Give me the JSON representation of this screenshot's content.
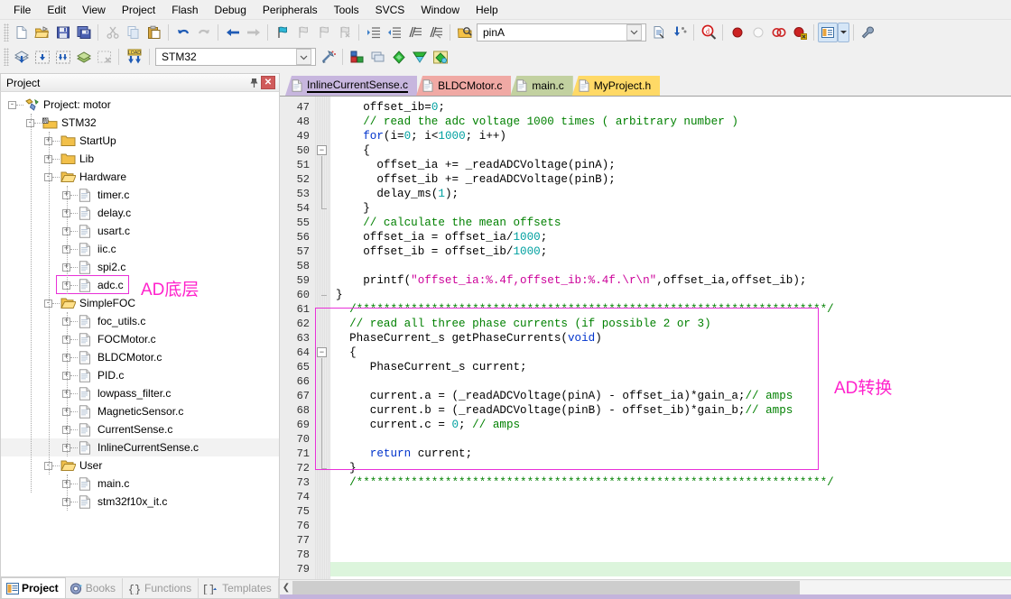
{
  "menu": {
    "items": [
      "File",
      "Edit",
      "View",
      "Project",
      "Flash",
      "Debug",
      "Peripherals",
      "Tools",
      "SVCS",
      "Window",
      "Help"
    ]
  },
  "toolbar1": {
    "icons": [
      "new-file-icon",
      "open-file-icon",
      "save-icon",
      "save-all-icon",
      "cut-icon",
      "copy-icon",
      "paste-icon",
      "undo-icon",
      "redo-icon",
      "navigate-back-icon",
      "navigate-forward-icon",
      "bookmark-toggle-icon",
      "bookmark-prev-icon",
      "bookmark-next-icon",
      "bookmark-clear-icon",
      "indent-right-icon",
      "indent-left-icon",
      "comment-icon",
      "uncomment-icon",
      "find-in-files-icon"
    ],
    "search_value": "pinA",
    "search_placeholder": "",
    "combo_arrow": "chevron-down-icon",
    "after_icons": [
      "browse-symbols-icon",
      "find-references-icon",
      "find-icon",
      "insert-breakpoint-icon",
      "disable-breakpoint-icon",
      "kill-all-breakpoints-icon",
      "disable-all-breakpoints-icon"
    ],
    "window_button": "manage-windows-icon",
    "window_arrow": "chevron-down-icon",
    "config_button": "configure-icon"
  },
  "toolbar2": {
    "icons": [
      "build-icon",
      "rebuild-icon",
      "batch-build-icon",
      "translate-icon",
      "stop-build-icon",
      "download-icon"
    ],
    "target_value": "STM32",
    "target_arrow": "chevron-down-icon",
    "after_icons": [
      "target-options-icon",
      "manage-project-items-icon",
      "manage-multi-project-icon",
      "pack-installer-icon",
      "manage-runtime-icon",
      "software-packs-icon"
    ]
  },
  "project_pane": {
    "title": "Project",
    "pin_icon": "pin-icon",
    "close_icon": "close-icon",
    "tree": [
      {
        "label": "Project: motor",
        "depth": 0,
        "icon": "project-icon",
        "expander": "-",
        "selected": false
      },
      {
        "label": "STM32",
        "depth": 1,
        "icon": "target-icon",
        "expander": "-",
        "selected": false
      },
      {
        "label": "StartUp",
        "depth": 2,
        "icon": "folder-icon",
        "expander": "+",
        "selected": false
      },
      {
        "label": "Lib",
        "depth": 2,
        "icon": "folder-icon",
        "expander": "+",
        "selected": false
      },
      {
        "label": "Hardware",
        "depth": 2,
        "icon": "folder-open-icon",
        "expander": "-",
        "selected": false
      },
      {
        "label": "timer.c",
        "depth": 3,
        "icon": "c-file-icon",
        "expander": "+",
        "selected": false
      },
      {
        "label": "delay.c",
        "depth": 3,
        "icon": "c-file-icon",
        "expander": "+",
        "selected": false
      },
      {
        "label": "usart.c",
        "depth": 3,
        "icon": "c-file-icon",
        "expander": "+",
        "selected": false
      },
      {
        "label": "iic.c",
        "depth": 3,
        "icon": "c-file-icon",
        "expander": "+",
        "selected": false
      },
      {
        "label": "spi2.c",
        "depth": 3,
        "icon": "c-file-icon",
        "expander": "+",
        "selected": false
      },
      {
        "label": "adc.c",
        "depth": 3,
        "icon": "c-file-icon",
        "expander": "+",
        "selected": false
      },
      {
        "label": "SimpleFOC",
        "depth": 2,
        "icon": "folder-open-icon",
        "expander": "-",
        "selected": false
      },
      {
        "label": "foc_utils.c",
        "depth": 3,
        "icon": "c-file-icon",
        "expander": "+",
        "selected": false
      },
      {
        "label": "FOCMotor.c",
        "depth": 3,
        "icon": "c-file-icon",
        "expander": "+",
        "selected": false
      },
      {
        "label": "BLDCMotor.c",
        "depth": 3,
        "icon": "c-file-icon",
        "expander": "+",
        "selected": false
      },
      {
        "label": "PID.c",
        "depth": 3,
        "icon": "c-file-icon",
        "expander": "+",
        "selected": false
      },
      {
        "label": "lowpass_filter.c",
        "depth": 3,
        "icon": "c-file-icon",
        "expander": "+",
        "selected": false
      },
      {
        "label": "MagneticSensor.c",
        "depth": 3,
        "icon": "c-file-icon",
        "expander": "+",
        "selected": false
      },
      {
        "label": "CurrentSense.c",
        "depth": 3,
        "icon": "c-file-icon",
        "expander": "+",
        "selected": false
      },
      {
        "label": "InlineCurrentSense.c",
        "depth": 3,
        "icon": "c-file-icon",
        "expander": "+",
        "selected": true
      },
      {
        "label": "User",
        "depth": 2,
        "icon": "folder-open-icon",
        "expander": "-",
        "selected": false
      },
      {
        "label": "main.c",
        "depth": 3,
        "icon": "c-file-icon",
        "expander": "+",
        "selected": false
      },
      {
        "label": "stm32f10x_it.c",
        "depth": 3,
        "icon": "c-file-icon",
        "expander": "+",
        "selected": false
      }
    ],
    "bottom_tabs": [
      {
        "label": "Project",
        "icon": "project-tab-icon",
        "active": true
      },
      {
        "label": "Books",
        "icon": "books-tab-icon",
        "active": false
      },
      {
        "label": "Functions",
        "icon": "functions-tab-icon",
        "active": false
      },
      {
        "label": "Templates",
        "icon": "templates-tab-icon",
        "active": false
      }
    ]
  },
  "annotations": {
    "sidebar": {
      "text": "AD底层",
      "color": "#ff22cc"
    },
    "editor": {
      "text": "AD转换",
      "color": "#ff22cc"
    }
  },
  "editor": {
    "tabs": [
      {
        "label": "InlineCurrentSense.c",
        "color": "#c7b6de",
        "active": true
      },
      {
        "label": "BLDCMotor.c",
        "color": "#f0a9a4",
        "active": false
      },
      {
        "label": "main.c",
        "color": "#c2d1a0",
        "active": false
      },
      {
        "label": "MyProject.h",
        "color": "#ffd966",
        "active": false
      }
    ],
    "first_line_number": 47,
    "last_line_number": 79,
    "highlighted_line": 79,
    "lines": [
      {
        "n": 47,
        "tokens": [
          {
            "t": "    offset_ib=",
            "c": "plain"
          },
          {
            "t": "0",
            "c": "num"
          },
          {
            "t": ";",
            "c": "plain"
          }
        ]
      },
      {
        "n": 48,
        "tokens": [
          {
            "t": "    // read the adc voltage 1000 times ( arbitrary number )",
            "c": "cm"
          }
        ]
      },
      {
        "n": 49,
        "tokens": [
          {
            "t": "    ",
            "c": "plain"
          },
          {
            "t": "for",
            "c": "kw"
          },
          {
            "t": "(i=",
            "c": "plain"
          },
          {
            "t": "0",
            "c": "num"
          },
          {
            "t": "; i<",
            "c": "plain"
          },
          {
            "t": "1000",
            "c": "num"
          },
          {
            "t": "; i++)",
            "c": "plain"
          }
        ]
      },
      {
        "n": 50,
        "tokens": [
          {
            "t": "    {",
            "c": "plain"
          }
        ]
      },
      {
        "n": 51,
        "tokens": [
          {
            "t": "      offset_ia += _readADCVoltage(pinA);",
            "c": "plain"
          }
        ]
      },
      {
        "n": 52,
        "tokens": [
          {
            "t": "      offset_ib += _readADCVoltage(pinB);",
            "c": "plain"
          }
        ]
      },
      {
        "n": 53,
        "tokens": [
          {
            "t": "      delay_ms(",
            "c": "plain"
          },
          {
            "t": "1",
            "c": "num"
          },
          {
            "t": ");",
            "c": "plain"
          }
        ]
      },
      {
        "n": 54,
        "tokens": [
          {
            "t": "    }",
            "c": "plain"
          }
        ]
      },
      {
        "n": 55,
        "tokens": [
          {
            "t": "    // calculate the mean offsets",
            "c": "cm"
          }
        ]
      },
      {
        "n": 56,
        "tokens": [
          {
            "t": "    offset_ia = offset_ia/",
            "c": "plain"
          },
          {
            "t": "1000",
            "c": "num"
          },
          {
            "t": ";",
            "c": "plain"
          }
        ]
      },
      {
        "n": 57,
        "tokens": [
          {
            "t": "    offset_ib = offset_ib/",
            "c": "plain"
          },
          {
            "t": "1000",
            "c": "num"
          },
          {
            "t": ";",
            "c": "plain"
          }
        ]
      },
      {
        "n": 58,
        "tokens": [
          {
            "t": "",
            "c": "plain"
          }
        ]
      },
      {
        "n": 59,
        "tokens": [
          {
            "t": "    printf(",
            "c": "plain"
          },
          {
            "t": "\"offset_ia:%.4f,offset_ib:%.4f.\\r\\n\"",
            "c": "str"
          },
          {
            "t": ",offset_ia,offset_ib);",
            "c": "plain"
          }
        ]
      },
      {
        "n": 60,
        "tokens": [
          {
            "t": "}",
            "c": "plain"
          }
        ]
      },
      {
        "n": 61,
        "tokens": [
          {
            "t": "  /*********************************************************************/",
            "c": "cm"
          }
        ]
      },
      {
        "n": 62,
        "tokens": [
          {
            "t": "  // read all three phase currents (if possible 2 or 3)",
            "c": "cm"
          }
        ]
      },
      {
        "n": 63,
        "tokens": [
          {
            "t": "  PhaseCurrent_s getPhaseCurrents(",
            "c": "plain"
          },
          {
            "t": "void",
            "c": "kw"
          },
          {
            "t": ")",
            "c": "plain"
          }
        ]
      },
      {
        "n": 64,
        "tokens": [
          {
            "t": "  {",
            "c": "plain"
          }
        ]
      },
      {
        "n": 65,
        "tokens": [
          {
            "t": "     PhaseCurrent_s current;",
            "c": "plain"
          }
        ]
      },
      {
        "n": 66,
        "tokens": [
          {
            "t": "",
            "c": "plain"
          }
        ]
      },
      {
        "n": 67,
        "tokens": [
          {
            "t": "     current.a = (_readADCVoltage(pinA) - offset_ia)*gain_a;",
            "c": "plain"
          },
          {
            "t": "// amps",
            "c": "cm"
          }
        ]
      },
      {
        "n": 68,
        "tokens": [
          {
            "t": "     current.b = (_readADCVoltage(pinB) - offset_ib)*gain_b;",
            "c": "plain"
          },
          {
            "t": "// amps",
            "c": "cm"
          }
        ]
      },
      {
        "n": 69,
        "tokens": [
          {
            "t": "     current.c = ",
            "c": "plain"
          },
          {
            "t": "0",
            "c": "num"
          },
          {
            "t": "; ",
            "c": "plain"
          },
          {
            "t": "// amps",
            "c": "cm"
          }
        ]
      },
      {
        "n": 70,
        "tokens": [
          {
            "t": "",
            "c": "plain"
          }
        ]
      },
      {
        "n": 71,
        "tokens": [
          {
            "t": "     ",
            "c": "plain"
          },
          {
            "t": "return",
            "c": "kw"
          },
          {
            "t": " current;",
            "c": "plain"
          }
        ]
      },
      {
        "n": 72,
        "tokens": [
          {
            "t": "  }",
            "c": "plain"
          }
        ]
      },
      {
        "n": 73,
        "tokens": [
          {
            "t": "  /*********************************************************************/",
            "c": "cm"
          }
        ]
      },
      {
        "n": 74,
        "tokens": [
          {
            "t": "",
            "c": "plain"
          }
        ]
      },
      {
        "n": 75,
        "tokens": [
          {
            "t": "",
            "c": "plain"
          }
        ]
      },
      {
        "n": 76,
        "tokens": [
          {
            "t": "",
            "c": "plain"
          }
        ]
      },
      {
        "n": 77,
        "tokens": [
          {
            "t": "",
            "c": "plain"
          }
        ]
      },
      {
        "n": 78,
        "tokens": [
          {
            "t": "",
            "c": "plain"
          }
        ]
      },
      {
        "n": 79,
        "tokens": [
          {
            "t": "",
            "c": "plain"
          }
        ]
      }
    ],
    "hscroll": {
      "left_arrow": "chevron-left-icon"
    }
  }
}
